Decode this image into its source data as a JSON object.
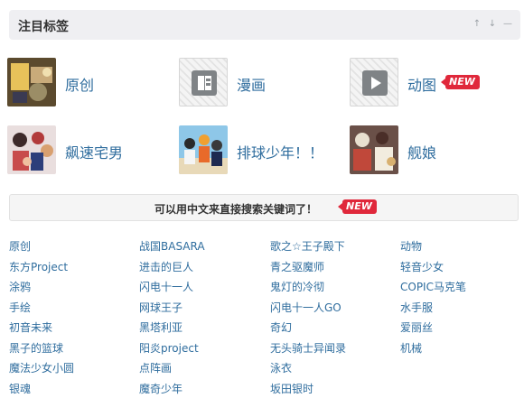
{
  "section": {
    "title": "注目标签",
    "controls": [
      "↑",
      "↓",
      "—"
    ]
  },
  "featured_tags": [
    {
      "label": "原创",
      "new": false
    },
    {
      "label": "漫画",
      "new": false
    },
    {
      "label": "动图",
      "new": true
    },
    {
      "label": "飙速宅男",
      "new": false
    },
    {
      "label": "排球少年！！",
      "new": false
    },
    {
      "label": "舰娘",
      "new": false
    }
  ],
  "new_badge_text": "NEW",
  "search_notice": {
    "text": "可以用中文来直接搜索关键词了！",
    "badge": "NEW"
  },
  "tag_columns": [
    [
      "原创",
      "东方Project",
      "涂鸦",
      "手绘",
      "初音未来",
      "黑子的篮球",
      "魔法少女小圆",
      "银魂"
    ],
    [
      "战国BASARA",
      "进击的巨人",
      "闪电十一人",
      "网球王子",
      "黑塔利亚",
      "阳炎project",
      "点阵画",
      "魔奇少年"
    ],
    [
      "歌之☆王子殿下",
      "青之驱魔师",
      "鬼灯的冷彻",
      "闪电十一人GO",
      "奇幻",
      "无头骑士异闻录",
      "泳衣",
      "坂田银时"
    ],
    [
      "动物",
      "轻音少女",
      "COPIC马克笔",
      "水手服",
      "爱丽丝",
      "机械"
    ]
  ]
}
